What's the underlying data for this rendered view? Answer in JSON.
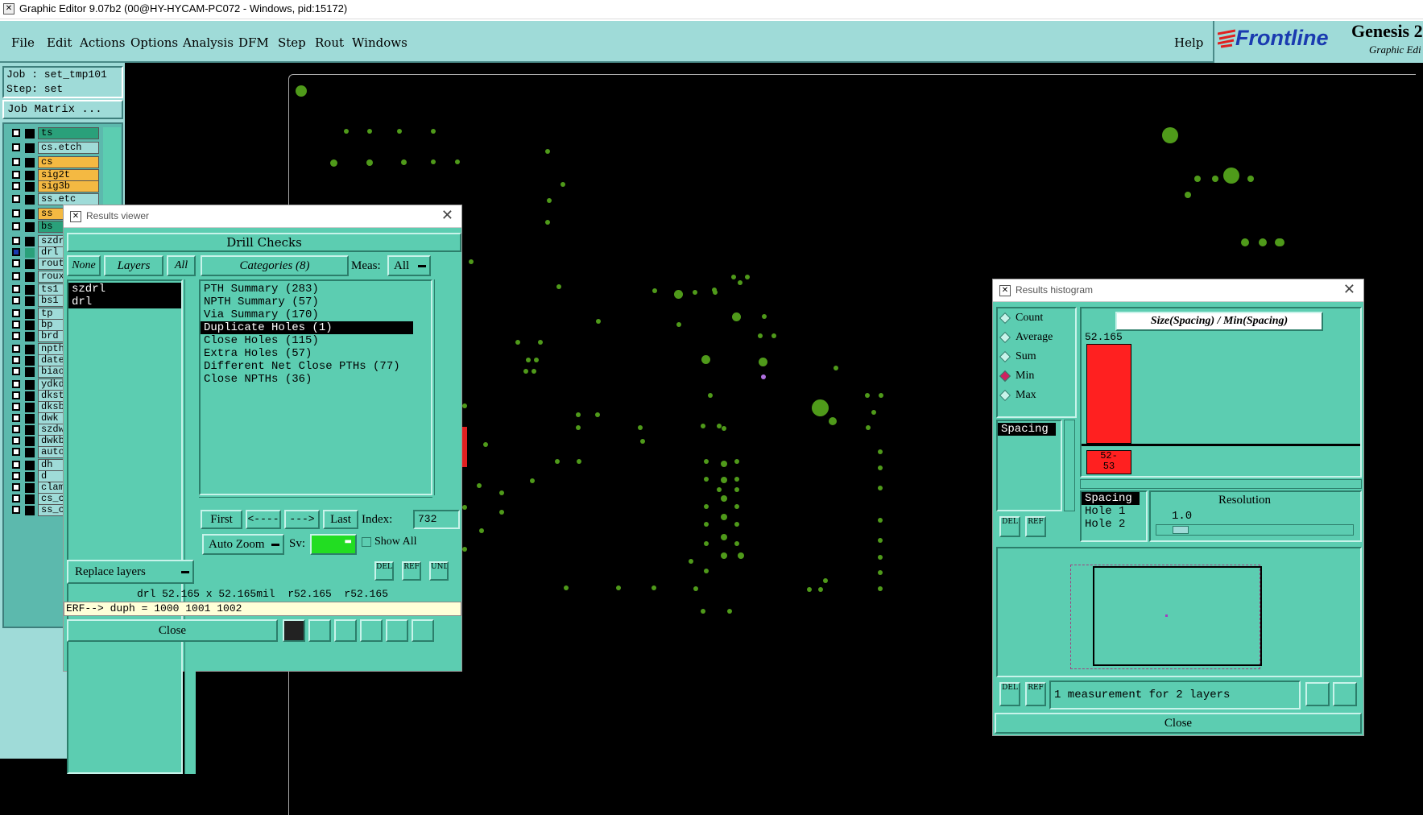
{
  "window_title": "Graphic Editor 9.07b2 (00@HY-HYCAM-PC072 - Windows, pid:15172)",
  "menu": [
    "File",
    "Edit",
    "Actions",
    "Options",
    "Analysis",
    "DFM",
    "Step",
    "Rout",
    "Windows"
  ],
  "help": "Help",
  "brand": {
    "logo": "Frontline",
    "product": "Genesis 2",
    "subtitle": "Graphic Edi"
  },
  "job": {
    "job_label": "Job : set_tmp101",
    "step_label": "Step: set",
    "matrix_button": "Job Matrix ..."
  },
  "layers": [
    {
      "name": "ts",
      "color": "#2aa07a"
    },
    {
      "name": "cs.etch",
      "color": "#9fdbd8"
    },
    {
      "name": "cs",
      "color": "#f4b942"
    },
    {
      "name": "sig2t",
      "color": "#f4b942"
    },
    {
      "name": "sig3b",
      "color": "#f4b942"
    },
    {
      "name": "ss.etc",
      "color": "#9fdbd8"
    },
    {
      "name": "ss",
      "color": "#f4b942"
    },
    {
      "name": "bs",
      "color": "#2aa07a"
    },
    {
      "name": "szdrl",
      "color": "#9fdbd8"
    },
    {
      "name": "drl",
      "color": "#9fdbd8"
    },
    {
      "name": "rout",
      "color": "#9fdbd8"
    },
    {
      "name": "rouxb",
      "color": "#9fdbd8"
    },
    {
      "name": "ts1",
      "color": "#9fdbd8"
    },
    {
      "name": "bs1",
      "color": "#9fdbd8"
    },
    {
      "name": "tp",
      "color": "#9fdbd8"
    },
    {
      "name": "bp",
      "color": "#9fdbd8"
    },
    {
      "name": "brd",
      "color": "#9fdbd8"
    },
    {
      "name": "npth",
      "color": "#9fdbd8"
    },
    {
      "name": "datec",
      "color": "#9fdbd8"
    },
    {
      "name": "biaoz",
      "color": "#9fdbd8"
    },
    {
      "name": "ydkdr",
      "color": "#9fdbd8"
    },
    {
      "name": "dkst",
      "color": "#9fdbd8"
    },
    {
      "name": "dksb",
      "color": "#9fdbd8"
    },
    {
      "name": "dwk",
      "color": "#9fdbd8"
    },
    {
      "name": "szdwk",
      "color": "#9fdbd8"
    },
    {
      "name": "dwkby",
      "color": "#9fdbd8"
    },
    {
      "name": "auto_",
      "color": "#9fdbd8"
    },
    {
      "name": "dh",
      "color": "#9fdbd8"
    },
    {
      "name": "d",
      "color": "#9fdbd8"
    },
    {
      "name": "clamp",
      "color": "#9fdbd8"
    },
    {
      "name": "cs_cl",
      "color": "#9fdbd8"
    },
    {
      "name": "ss_cl",
      "color": "#9fdbd8"
    }
  ],
  "results_viewer": {
    "title": "Results viewer",
    "header": "Drill Checks",
    "none_btn": "None",
    "layers_btn": "Layers",
    "all_btn": "All",
    "layer_list": [
      "szdrl",
      "drl"
    ],
    "categories_btn": "Categories (8)",
    "meas_label": "Meas:",
    "meas_value": "All",
    "categories": [
      "PTH Summary (283)",
      "NPTH Summary (57)",
      "Via Summary (170)",
      "Duplicate Holes (1)",
      "Close Holes (115)",
      "Extra Holes (57)",
      "Different Net Close PTHs (77)",
      "Close NPTHs (36)"
    ],
    "selected_category": 3,
    "first": "First",
    "prev": "<----",
    "next": "--->",
    "last": "Last",
    "index_label": "Index:",
    "index_value": "732",
    "auto_zoom": "Auto Zoom",
    "sv_label": "Sv:",
    "show_all": "Show All",
    "replace_layers": "Replace layers",
    "del": "DEL",
    "ref": "REF",
    "undo": "UNDO",
    "status": "drl 52.165 x 52.165mil  r52.165  r52.165",
    "erf": "ERF--> duph = 1000 1001 1002",
    "close": "Close",
    "sv_color": "#22dd22"
  },
  "histogram": {
    "title": "Results histogram",
    "modes": [
      "Count",
      "Average",
      "Sum",
      "Min",
      "Max"
    ],
    "selected_mode": 3,
    "measure_list": [
      "Spacing"
    ],
    "heading": "Size(Spacing) / Min(Spacing)",
    "bar_value_label": "52.165",
    "bin_label": "52-\n53",
    "sort_list": [
      "Spacing",
      "Hole 1",
      "Hole 2"
    ],
    "resolution_label": "Resolution",
    "resolution_value": "1.0",
    "status": "1 measurement for 2 layers",
    "close": "Close",
    "del": "DEL",
    "ref": "REF",
    "bar_color": "#ff2020"
  }
}
